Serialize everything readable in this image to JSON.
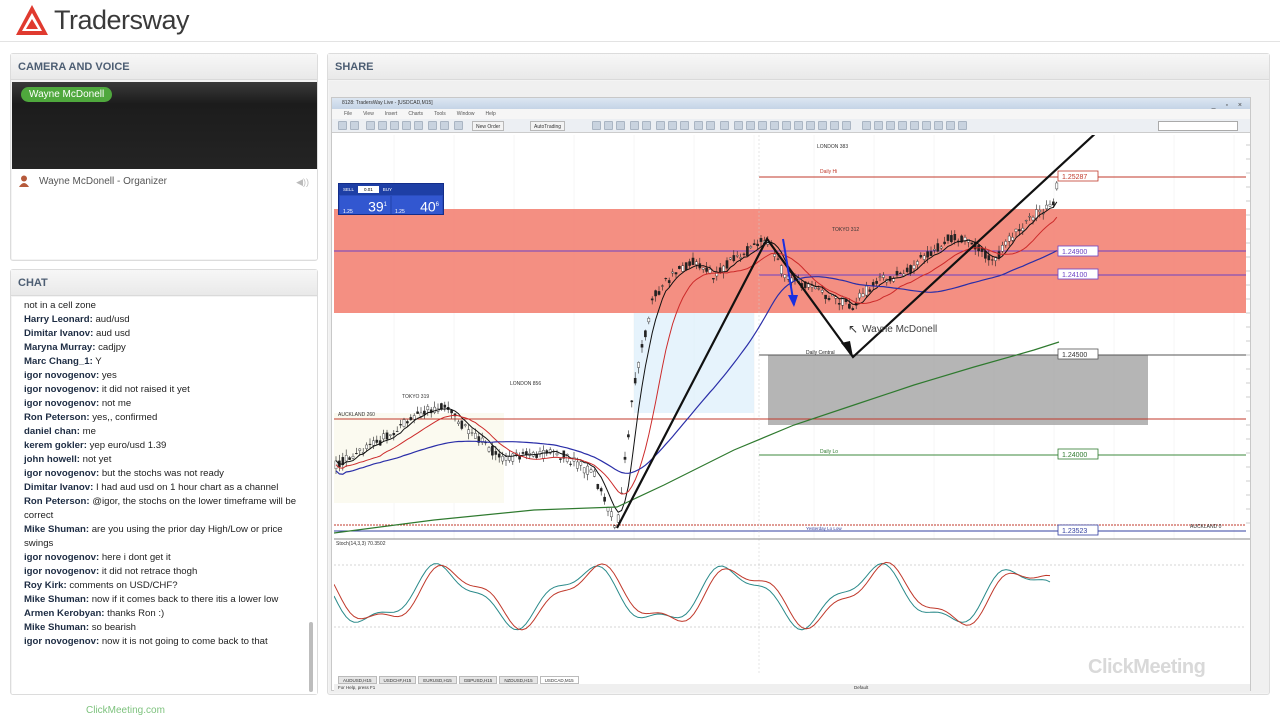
{
  "header": {
    "brand": "Tradersway"
  },
  "camera": {
    "title": "CAMERA AND VOICE",
    "presenter_tag": "Wayne McDonell",
    "attendee": "Wayne McDonell - Organizer"
  },
  "chat": {
    "title": "CHAT",
    "messages": [
      {
        "user": "",
        "text": "not in a cell zone"
      },
      {
        "user": "Harry Leonard:",
        "text": " aud/usd"
      },
      {
        "user": "Dimitar Ivanov:",
        "text": " aud usd"
      },
      {
        "user": "Maryna Murray:",
        "text": " cadjpy"
      },
      {
        "user": "Marc Chang_1:",
        "text": " Y"
      },
      {
        "user": "igor novogenov:",
        "text": " yes"
      },
      {
        "user": "igor novogenov:",
        "text": " it did not raised it yet"
      },
      {
        "user": "igor novogenov:",
        "text": " not me"
      },
      {
        "user": "Ron Peterson:",
        "text": " yes,, confirmed"
      },
      {
        "user": "daniel chan:",
        "text": " me"
      },
      {
        "user": "kerem gokler:",
        "text": " yep euro/usd 1.39"
      },
      {
        "user": "john howell:",
        "text": " not yet"
      },
      {
        "user": "igor novogenov:",
        "text": " but the stochs was not ready"
      },
      {
        "user": "Dimitar Ivanov:",
        "text": " I had aud usd on 1 hour chart as a channel"
      },
      {
        "user": "Ron Peterson:",
        "text": " @igor, the stochs on the lower timeframe will be correct"
      },
      {
        "user": "Mike Shuman:",
        "text": " are you using the prior day High/Low or price swings"
      },
      {
        "user": "igor novogenov:",
        "text": " here i dont get it"
      },
      {
        "user": "igor novogenov:",
        "text": " it did not retrace thogh"
      },
      {
        "user": "Roy Kirk:",
        "text": " comments on USD/CHF?"
      },
      {
        "user": "Mike Shuman:",
        "text": " now if it comes back to there itis a lower low"
      },
      {
        "user": "Armen Kerobyan:",
        "text": " thanks Ron :)"
      },
      {
        "user": "Mike Shuman:",
        "text": " so bearish"
      },
      {
        "user": "igor novogenov:",
        "text": " now it is not going to come back to that"
      }
    ]
  },
  "share": {
    "title": "SHARE",
    "terminal": {
      "window_title": "8128: TradersWay Live - [USDCAD,M15]",
      "menu": [
        "File",
        "View",
        "Insert",
        "Charts",
        "Tools",
        "Window",
        "Help"
      ],
      "new_order": "New Order",
      "autotrading": "AutoTrading",
      "trade_panel": {
        "symbol": "SELL",
        "lot": "0.01",
        "buy": "BUY",
        "sell_price": "39",
        "sell_small": "1.25",
        "sell_sup": "1",
        "buy_price": "40",
        "buy_small": "1.25",
        "buy_sup": "6"
      },
      "tabs": [
        "AUDUSD,H15",
        "USDCHF,H15",
        "EURUSD,H15",
        "GBPUSD,H15",
        "NZDUSD,H15",
        "USDCAD,M15"
      ],
      "status_left": "For Help, press F1",
      "status_mid": "Default",
      "chart_labels": {
        "london": "LONDON 383",
        "london2": "LONDON 856",
        "tokyo": "TOKYO 319",
        "tokyo2": "TOKYO 312",
        "auckland": "AUCKLAND 260",
        "auckland2": "AUCKLAND 0",
        "daily_central": "Daily Central",
        "daily_hi": "Daily Hi",
        "daily_lo": "Daily Lo",
        "yesterday_lo": "Yesterday Lo Low",
        "sto": "Stoch(14,3,3) 70.3502",
        "hi_label": "Daily Hi",
        "price_1": "1.25287",
        "price_2": "1.24900",
        "price_3": "1.24100",
        "price_4": "1.24500",
        "price_5": "1.24000",
        "price_6": "1.23523"
      }
    },
    "presenter_label": "Wayne McDonell"
  },
  "footer": {
    "link": "ClickMeeting.com",
    "watermark": "ClickMeeting"
  }
}
